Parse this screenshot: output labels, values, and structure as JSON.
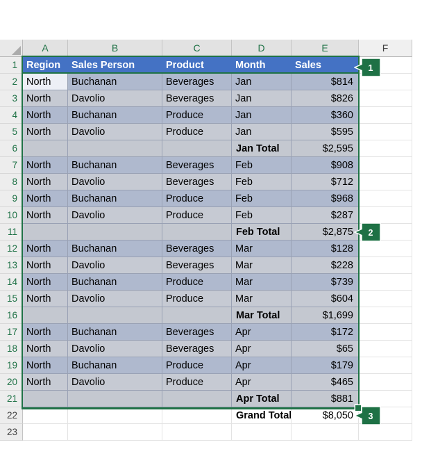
{
  "colors": {
    "header_fill": "#4472C4",
    "selection_green": "#1F7246",
    "badge_green": "#1E7145",
    "band_dark": "#AFB9CE",
    "band_light": "#C6CAD3",
    "subtotal_fill": "#C4C8D0",
    "active_cell_fill": "#EDEFF6"
  },
  "sheet": {
    "columns": [
      {
        "letter": "A",
        "selected": true
      },
      {
        "letter": "B",
        "selected": true
      },
      {
        "letter": "C",
        "selected": true
      },
      {
        "letter": "D",
        "selected": true
      },
      {
        "letter": "E",
        "selected": true
      },
      {
        "letter": "F",
        "selected": false
      }
    ],
    "row_numbers": [
      1,
      2,
      3,
      4,
      5,
      6,
      7,
      8,
      9,
      10,
      11,
      12,
      13,
      14,
      15,
      16,
      17,
      18,
      19,
      20,
      21,
      22,
      23
    ],
    "selected_rows_through": 21
  },
  "table": {
    "header": {
      "region": "Region",
      "person": "Sales Person",
      "product": "Product",
      "month": "Month",
      "sales": "Sales"
    },
    "rows": [
      {
        "row": 2,
        "type": "data",
        "band": "dark",
        "active_cell": true,
        "region": "North",
        "person": "Buchanan",
        "product": "Beverages",
        "month": "Jan",
        "sales": "$814"
      },
      {
        "row": 3,
        "type": "data",
        "band": "light",
        "region": "North",
        "person": "Davolio",
        "product": "Beverages",
        "month": "Jan",
        "sales": "$826"
      },
      {
        "row": 4,
        "type": "data",
        "band": "dark",
        "region": "North",
        "person": "Buchanan",
        "product": "Produce",
        "month": "Jan",
        "sales": "$360"
      },
      {
        "row": 5,
        "type": "data",
        "band": "light",
        "region": "North",
        "person": "Davolio",
        "product": "Produce",
        "month": "Jan",
        "sales": "$595"
      },
      {
        "row": 6,
        "type": "subtotal",
        "month": "Jan Total",
        "sales": "$2,595"
      },
      {
        "row": 7,
        "type": "data",
        "band": "dark",
        "region": "North",
        "person": "Buchanan",
        "product": "Beverages",
        "month": "Feb",
        "sales": "$908"
      },
      {
        "row": 8,
        "type": "data",
        "band": "light",
        "region": "North",
        "person": "Davolio",
        "product": "Beverages",
        "month": "Feb",
        "sales": "$712"
      },
      {
        "row": 9,
        "type": "data",
        "band": "dark",
        "region": "North",
        "person": "Buchanan",
        "product": "Produce",
        "month": "Feb",
        "sales": "$968"
      },
      {
        "row": 10,
        "type": "data",
        "band": "light",
        "region": "North",
        "person": "Davolio",
        "product": "Produce",
        "month": "Feb",
        "sales": "$287"
      },
      {
        "row": 11,
        "type": "subtotal",
        "month": "Feb Total",
        "sales": "$2,875"
      },
      {
        "row": 12,
        "type": "data",
        "band": "dark",
        "region": "North",
        "person": "Buchanan",
        "product": "Beverages",
        "month": "Mar",
        "sales": "$128"
      },
      {
        "row": 13,
        "type": "data",
        "band": "light",
        "region": "North",
        "person": "Davolio",
        "product": "Beverages",
        "month": "Mar",
        "sales": "$228"
      },
      {
        "row": 14,
        "type": "data",
        "band": "dark",
        "region": "North",
        "person": "Buchanan",
        "product": "Produce",
        "month": "Mar",
        "sales": "$739"
      },
      {
        "row": 15,
        "type": "data",
        "band": "light",
        "region": "North",
        "person": "Davolio",
        "product": "Produce",
        "month": "Mar",
        "sales": "$604"
      },
      {
        "row": 16,
        "type": "subtotal",
        "month": "Mar Total",
        "sales": "$1,699"
      },
      {
        "row": 17,
        "type": "data",
        "band": "dark",
        "region": "North",
        "person": "Buchanan",
        "product": "Beverages",
        "month": "Apr",
        "sales": "$172"
      },
      {
        "row": 18,
        "type": "data",
        "band": "light",
        "region": "North",
        "person": "Davolio",
        "product": "Beverages",
        "month": "Apr",
        "sales": "$65"
      },
      {
        "row": 19,
        "type": "data",
        "band": "dark",
        "region": "North",
        "person": "Buchanan",
        "product": "Produce",
        "month": "Apr",
        "sales": "$179"
      },
      {
        "row": 20,
        "type": "data",
        "band": "light",
        "region": "North",
        "person": "Davolio",
        "product": "Produce",
        "month": "Apr",
        "sales": "$465"
      },
      {
        "row": 21,
        "type": "subtotal",
        "month": "Apr Total",
        "sales": "$881"
      },
      {
        "row": 22,
        "type": "grand",
        "month": "Grand Total",
        "sales": "$8,050"
      }
    ]
  },
  "badges": [
    {
      "label": "1"
    },
    {
      "label": "2"
    },
    {
      "label": "3"
    }
  ]
}
